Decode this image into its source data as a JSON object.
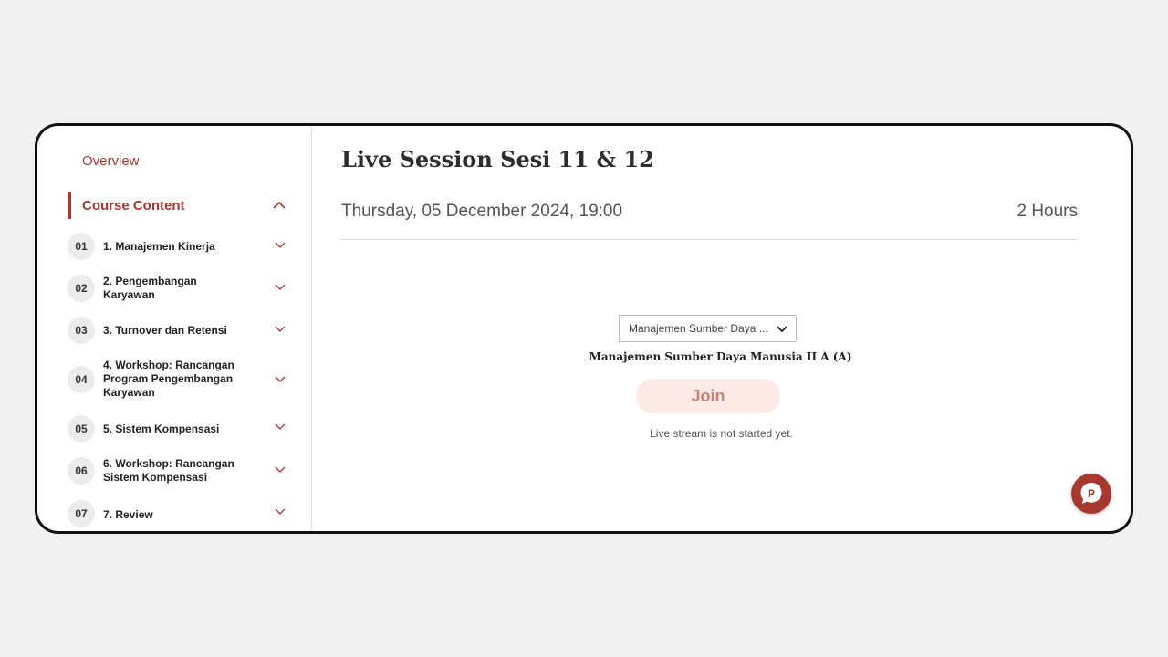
{
  "sidebar": {
    "overview_label": "Overview",
    "course_content_label": "Course Content",
    "modules": [
      {
        "num": "01",
        "title": "1. Manajemen Kinerja"
      },
      {
        "num": "02",
        "title": "2. Pengembangan Karyawan"
      },
      {
        "num": "03",
        "title": "3. Turnover dan Retensi"
      },
      {
        "num": "04",
        "title": "4. Workshop: Rancangan Program Pengembangan Karyawan"
      },
      {
        "num": "05",
        "title": "5. Sistem Kompensasi"
      },
      {
        "num": "06",
        "title": "6. Workshop: Rancangan Sistem Kompensasi"
      },
      {
        "num": "07",
        "title": "7. Review"
      }
    ]
  },
  "main": {
    "title": "Live Session Sesi 11 & 12",
    "date": "Thursday, 05 December 2024, 19:00",
    "duration": "2 Hours",
    "class_select": "Manajemen Sumber Daya ...",
    "session_name": "Manajemen Sumber Daya Manusia II A (A)",
    "join_label": "Join",
    "status": "Live stream is not started yet."
  },
  "colors": {
    "accent": "#a8372d",
    "join_bg": "#fbeae5",
    "join_text": "#c98073"
  },
  "icons": {
    "collapse": "chevron-up-icon",
    "expand": "chevron-down-icon",
    "help": "chat-p-icon"
  }
}
